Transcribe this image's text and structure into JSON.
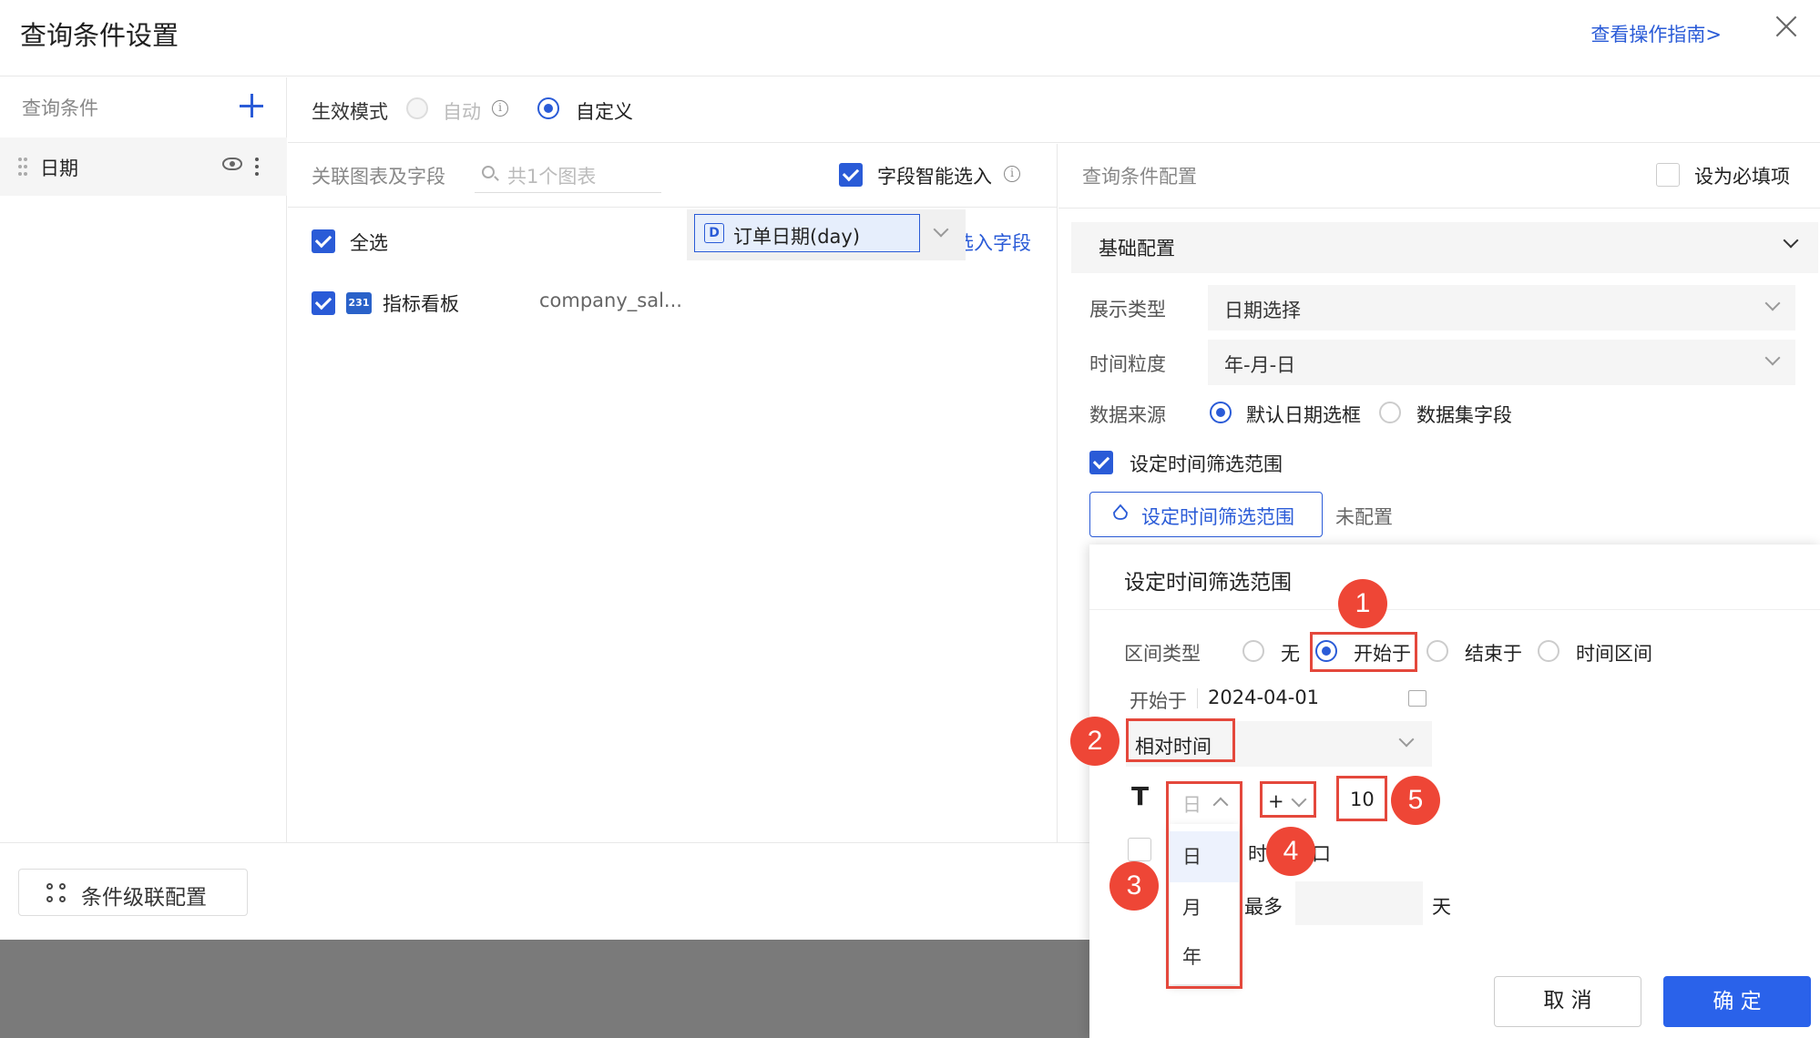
{
  "modal": {
    "title": "查询条件设置",
    "guide_link": "查看操作指南>"
  },
  "sidebar": {
    "header": "查询条件",
    "items": [
      {
        "label": "日期"
      }
    ]
  },
  "mode": {
    "label": "生效模式",
    "options": [
      {
        "label": "自动",
        "selected": false,
        "disabled": true
      },
      {
        "label": "自定义",
        "selected": true,
        "disabled": false
      }
    ]
  },
  "fields_panel": {
    "header": "关联图表及字段",
    "search_placeholder": "共1个图表",
    "smart_select_label": "字段智能选入",
    "smart_select_checked": true,
    "select_all_label": "全选",
    "clear_link": "清空选入字段",
    "rows": [
      {
        "chart_name": "指标看板",
        "icon_text": "231",
        "dataset": "company_sal...",
        "field_icon": "D",
        "field": "订单日期(day)",
        "checked": true
      }
    ]
  },
  "config_panel": {
    "header": "查询条件配置",
    "required_label": "设为必填项",
    "required_checked": false,
    "section_title": "基础配置",
    "display_type_label": "展示类型",
    "display_type_value": "日期选择",
    "granularity_label": "时间粒度",
    "granularity_value": "年-月-日",
    "source_label": "数据来源",
    "source_options": [
      {
        "label": "默认日期选框",
        "selected": true
      },
      {
        "label": "数据集字段",
        "selected": false
      }
    ],
    "range_checkbox_label": "设定时间筛选范围",
    "range_checkbox_checked": true,
    "range_button_label": "设定时间筛选范围",
    "range_status": "未配置"
  },
  "range_popup": {
    "title": "设定时间筛选范围",
    "interval_label": "区间类型",
    "interval_options": [
      {
        "label": "无",
        "selected": false
      },
      {
        "label": "开始于",
        "selected": true
      },
      {
        "label": "结束于",
        "selected": false
      },
      {
        "label": "时间区间",
        "selected": false
      }
    ],
    "start_label": "开始于",
    "start_date": "2024-04-01",
    "time_mode": "相对时间",
    "t_glyph": "T",
    "unit_value": "日",
    "unit_options": [
      "日",
      "月",
      "年"
    ],
    "sign_value": "+",
    "offset_value": "10",
    "partial_label_1": "时",
    "partial_label_1b": "口",
    "partial_label_2": "最多",
    "day_suffix": "天"
  },
  "annotations": [
    "1",
    "2",
    "3",
    "4",
    "5"
  ],
  "footer": {
    "cascade_label": "条件级联配置",
    "cancel_label": "取 消",
    "ok_label": "确 定"
  },
  "colors": {
    "accent": "#2a5bd7",
    "highlight_red": "#e4483c",
    "badge_red": "#ee4636",
    "ok_button": "#2a62ea"
  }
}
